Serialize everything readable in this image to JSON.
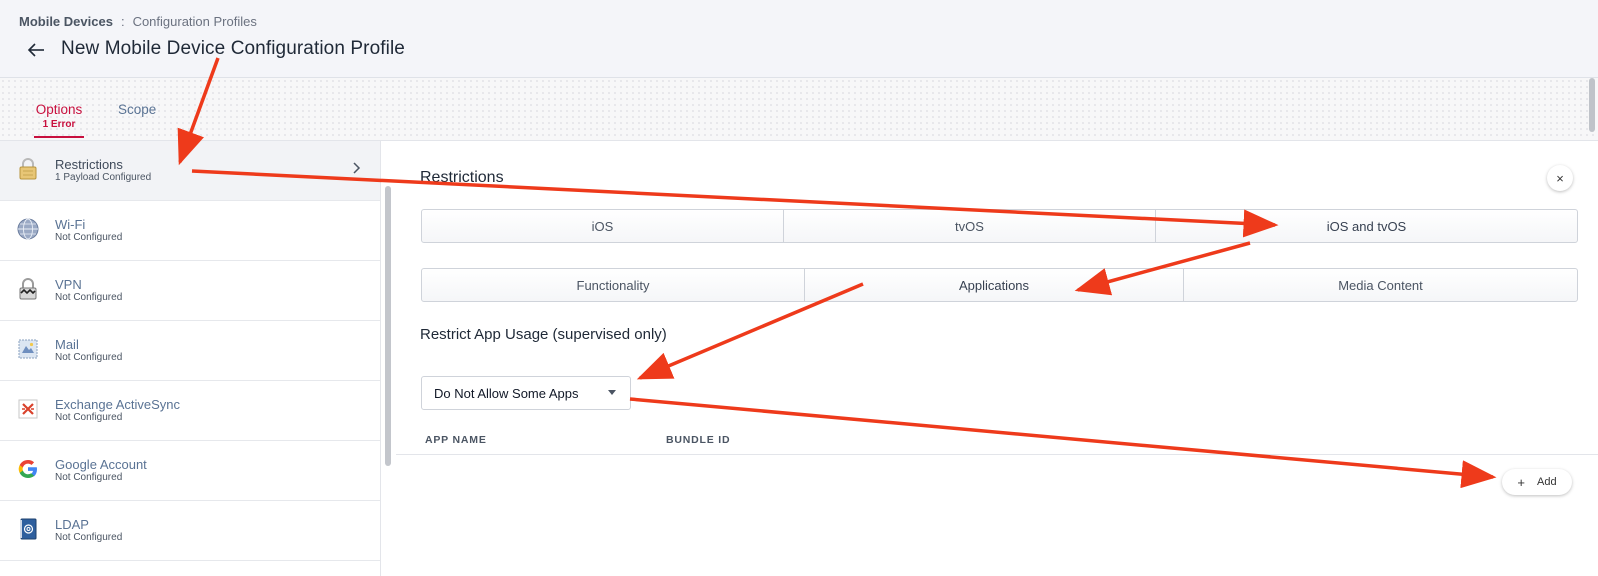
{
  "breadcrumb": {
    "parent": "Mobile Devices",
    "separator": ":",
    "current": "Configuration Profiles"
  },
  "page_title": "New Mobile Device Configuration Profile",
  "tabs": {
    "options": {
      "label": "Options",
      "sub": "1 Error"
    },
    "scope": {
      "label": "Scope"
    }
  },
  "sidebar": {
    "items": [
      {
        "title": "Restrictions",
        "sub": "1 Payload Configured",
        "icon": "lock-icon"
      },
      {
        "title": "Wi-Fi",
        "sub": "Not Configured",
        "icon": "globe-icon"
      },
      {
        "title": "VPN",
        "sub": "Not Configured",
        "icon": "vpn-lock-icon"
      },
      {
        "title": "Mail",
        "sub": "Not Configured",
        "icon": "mail-stamp-icon"
      },
      {
        "title": "Exchange ActiveSync",
        "sub": "Not Configured",
        "icon": "exchange-icon"
      },
      {
        "title": "Google Account",
        "sub": "Not Configured",
        "icon": "google-icon"
      },
      {
        "title": "LDAP",
        "sub": "Not Configured",
        "icon": "ldap-book-icon"
      }
    ]
  },
  "main": {
    "section_title": "Restrictions",
    "close_label": "×",
    "platform_tabs": [
      "iOS",
      "tvOS",
      "iOS and tvOS"
    ],
    "category_tabs": [
      "Functionality",
      "Applications",
      "Media Content"
    ],
    "sub_title": "Restrict App Usage (supervised only)",
    "select_value": "Do Not Allow Some Apps",
    "columns": {
      "app_name": "APP NAME",
      "bundle_id": "BUNDLE ID"
    },
    "add_label": "Add",
    "add_plus": "+"
  },
  "colors": {
    "accent": "#c8103e",
    "link": "#5a7394",
    "arrow": "#ee3a1b"
  }
}
